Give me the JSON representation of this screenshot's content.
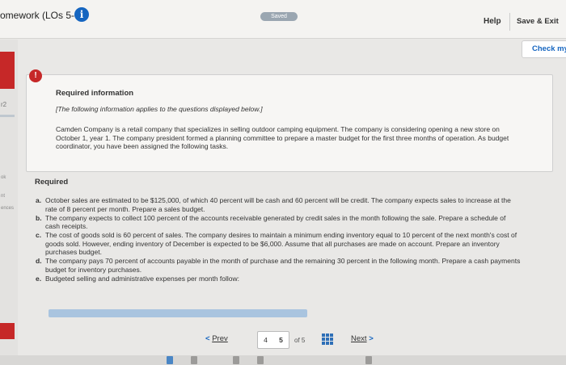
{
  "header": {
    "title": "omework (LOs 5-6)",
    "info_glyph": "i",
    "saved_status": "Saved",
    "help_label": "Help",
    "save_exit_label": "Save & Exit"
  },
  "actions": {
    "check_label": "Check my"
  },
  "sidebar": {
    "question_num": "r2",
    "labels": [
      "ok",
      "nt",
      "ences"
    ]
  },
  "required_info": {
    "badge": "!",
    "title": "Required information",
    "note": "[The following information applies to the questions displayed below.]",
    "body": "Camden Company is a retail company that specializes in selling outdoor camping equipment. The company is considering opening a new store on October 1, year 1. The company president formed a planning committee to prepare a master budget for the first three months of operation. As budget coordinator, you have been assigned the following tasks."
  },
  "required": {
    "heading": "Required",
    "items": [
      {
        "letter": "a.",
        "text": "October sales are estimated to be $125,000, of which 40 percent will be cash and 60 percent will be credit. The company expects sales to increase at the rate of 8 percent per month. Prepare a sales budget."
      },
      {
        "letter": "b.",
        "text": "The company expects to collect 100 percent of the accounts receivable generated by credit sales in the month following the sale. Prepare a schedule of cash receipts."
      },
      {
        "letter": "c.",
        "text": "The cost of goods sold is 60 percent of sales. The company desires to maintain a minimum ending inventory equal to 10 percent of the next month's cost of goods sold. However, ending inventory of December is expected to be $6,000. Assume that all purchases are made on account. Prepare an inventory purchases budget."
      },
      {
        "letter": "d.",
        "text": "The company pays 70 percent of accounts payable in the month of purchase and the remaining 30 percent in the following month. Prepare a cash payments budget for inventory purchases."
      },
      {
        "letter": "e.",
        "text": "Budgeted selling and administrative expenses per month follow:"
      }
    ]
  },
  "progress": {
    "fraction": 1.0
  },
  "footer": {
    "prev_chevron": "<",
    "prev_label": "Prev",
    "page_prev": "4",
    "page_current": "5",
    "of_label": "of 5",
    "next_label": "Next",
    "next_chevron": ">"
  },
  "icons": {
    "info": "info-icon",
    "grid": "grid-icon",
    "prev": "chevron-left-icon",
    "next": "chevron-right-icon"
  },
  "colors": {
    "accent": "#1565c0",
    "alert": "#c62828",
    "saved": "#9aa6b1",
    "progress_fill": "#a9c4df"
  }
}
